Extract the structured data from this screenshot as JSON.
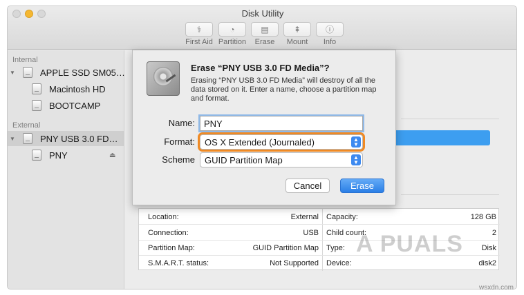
{
  "window": {
    "title": "Disk Utility"
  },
  "toolbar": {
    "items": [
      {
        "label": "First Aid",
        "icon": "stethoscope-icon"
      },
      {
        "label": "Partition",
        "icon": "pie-chart-icon"
      },
      {
        "label": "Erase",
        "icon": "erase-icon"
      },
      {
        "label": "Mount",
        "icon": "mount-icon"
      },
      {
        "label": "Info",
        "icon": "info-icon"
      }
    ]
  },
  "sidebar": {
    "internal_header": "Internal",
    "external_header": "External",
    "items": [
      {
        "label": "APPLE SSD SM05…"
      },
      {
        "label": "Macintosh HD"
      },
      {
        "label": "BOOTCAMP"
      },
      {
        "label": "PNY USB 3.0 FD…"
      },
      {
        "label": "PNY"
      }
    ]
  },
  "sheet": {
    "title": "Erase “PNY USB 3.0 FD Media”?",
    "description": "Erasing “PNY USB 3.0 FD Media” will destroy of all the data stored on it. Enter a name, choose a partition map and format.",
    "name_label": "Name:",
    "name_value": "PNY",
    "format_label": "Format:",
    "format_value": "OS X Extended (Journaled)",
    "scheme_label": "Scheme",
    "scheme_value": "GUID Partition Map",
    "cancel_label": "Cancel",
    "erase_label": "Erase"
  },
  "info": {
    "location_label": "Location:",
    "location_value": "External",
    "connection_label": "Connection:",
    "connection_value": "USB",
    "partition_map_label": "Partition Map:",
    "partition_map_value": "GUID Partition Map",
    "smart_label": "S.M.A.R.T. status:",
    "smart_value": "Not Supported",
    "capacity_label": "Capacity:",
    "capacity_value": "128 GB",
    "child_count_label": "Child count:",
    "child_count_value": "2",
    "type_label": "Type:",
    "type_value": "Disk",
    "device_label": "Device:",
    "device_value": "disk2"
  },
  "watermark": {
    "text": "A PUALS",
    "credit": "wsxdn.com"
  },
  "colors": {
    "accent": "#3d9ef0",
    "focus_ring": "#f08a24",
    "traffic_yellow": "#f5b731"
  }
}
